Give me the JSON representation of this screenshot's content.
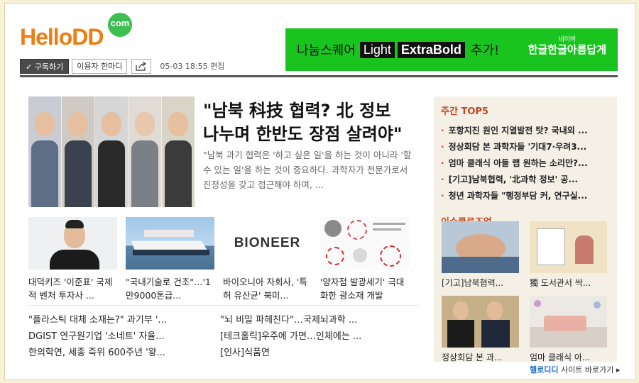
{
  "logo": {
    "text_main": "Hello",
    "text_dd": "DD",
    "text_dot": "com"
  },
  "toolbar": {
    "subscribe_label": "✓ 구독하기",
    "talk_label": "이용자 한마디",
    "date": "05-03 18:55 편집"
  },
  "ad": {
    "prefix": "나눔스퀘어",
    "light": "Light",
    "bold": "ExtraBold",
    "suffix": "추가!",
    "logo_small": "네이버",
    "logo_big": "한글한글아름답게"
  },
  "feature": {
    "headline_line1": "\"남북 科技 협력? 北 정보",
    "headline_line2": "나누며 한반도 장점 살려야\"",
    "lede": "\"남북 과기 협력은 '하고 싶은 일'을 하는 것이 아니라 '할 수 있는 일'을 하는 것이 중요하다. 과학자가 전문가로서 진정성을 갖고 접근해야 하며, ..."
  },
  "cards": [
    {
      "title": "대덕키즈 '이준표' 국제적 벤처 투자사 ..."
    },
    {
      "title": "\"국내기술로 건조\"…'1만9000톤급..."
    },
    {
      "title": "바이오니아 자회사, '특허 유산균' 북미..."
    },
    {
      "title": "'양자점 발광세기' 극대화한 광소재 개발"
    }
  ],
  "bioneer_logo": "BIONEER",
  "list_left": [
    "\"플라스틱 대체 소재는?\" 과기부 '...",
    "DGIST 연구원기업 '소네트' 자율...",
    "한의학연, 세종 즉위 600주년 '왕..."
  ],
  "list_right": [
    "\"뇌 비밀 파헤친다\"…국제뇌과학 ...",
    "[테크홀릭]우주에 가면…인체에는 ...",
    "[인사]식품연"
  ],
  "top5": {
    "title": "주간 TOP5",
    "items": [
      "포항지진 원인 지열발전 탓? 국내외 ...",
      "정상회담 본 과학자들 '기대7·우려3...",
      "엄마 클래식 아들 랩 원하는 소리만?...",
      "[기고]남북협력, '北과학 정보' 공...",
      "청년 과학자들 \"행정부담 커, 연구실..."
    ]
  },
  "issue": {
    "title": "이슈클로즈업",
    "items": [
      "[기고]남북협력...",
      "獨 도서관서 싹...",
      "정상회담 본 과...",
      "엄마 클래식 아..."
    ]
  },
  "shortcut": {
    "brand": "헬로디디",
    "text": " 사이트 바로가기 ▸"
  },
  "colors": {
    "brand_orange": "#f07d12",
    "ad_green": "#19c41e",
    "accent_red": "#c8461c"
  }
}
